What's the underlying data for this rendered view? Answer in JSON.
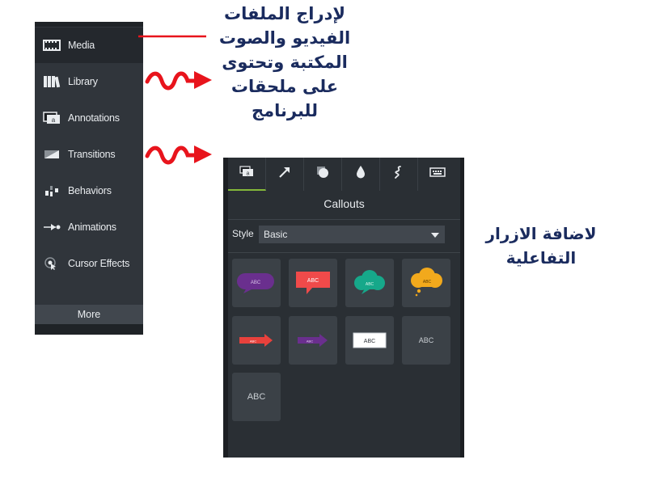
{
  "sidebar": {
    "items": [
      {
        "label": "Media",
        "icon": "film-icon",
        "active": true
      },
      {
        "label": "Library",
        "icon": "books-icon",
        "active": false
      },
      {
        "label": "Annotations",
        "icon": "callout-icon",
        "active": false
      },
      {
        "label": "Transitions",
        "icon": "transition-icon",
        "active": false
      },
      {
        "label": "Behaviors",
        "icon": "behaviors-icon",
        "active": false
      },
      {
        "label": "Animations",
        "icon": "animation-arrow-icon",
        "active": false
      },
      {
        "label": "Cursor Effects",
        "icon": "cursor-effects-icon",
        "active": false
      }
    ],
    "more_label": "More"
  },
  "panel": {
    "tabs": [
      "callout-icon",
      "arrow-icon",
      "shape-icon",
      "blur-drop-icon",
      "sketch-motion-icon",
      "keyboard-icon"
    ],
    "title": "Callouts",
    "style_label": "Style",
    "style_value": "Basic",
    "tiles": [
      {
        "shape": "speech-bubble-purple",
        "text": "ABC",
        "color": "#6a2f8e"
      },
      {
        "shape": "speech-rect-red",
        "text": "ABC",
        "color": "#f04a4a"
      },
      {
        "shape": "cloud-teal",
        "text": "ABC",
        "color": "#16a88a"
      },
      {
        "shape": "cloud-yellow",
        "text": "ABC",
        "color": "#f2a91c"
      },
      {
        "shape": "arrow-red",
        "text": "ABC",
        "color": "#e8413c"
      },
      {
        "shape": "arrow-purple",
        "text": "ABC",
        "color": "#6a2f8e"
      },
      {
        "shape": "white-box",
        "text": "ABC",
        "color": "#ffffff"
      },
      {
        "shape": "plain-text",
        "text": "ABC",
        "color": ""
      },
      {
        "shape": "plain-text-large",
        "text": "ABC",
        "color": ""
      }
    ]
  },
  "annotations": {
    "media_note": [
      "لإدراج الملفات",
      "الفيديو والصوت",
      "المكتبة وتحتوى",
      "على ملحقات",
      "للبرنامج"
    ],
    "callout_note": [
      "لاضافة الازرار",
      "التفاعلية"
    ]
  },
  "colors": {
    "sidebar_bg": "#30353b",
    "panel_bg": "#2a2f34",
    "accent_green": "#84b83a",
    "pointer_red": "#e8141c",
    "annotation_text": "#1a2b5e"
  }
}
